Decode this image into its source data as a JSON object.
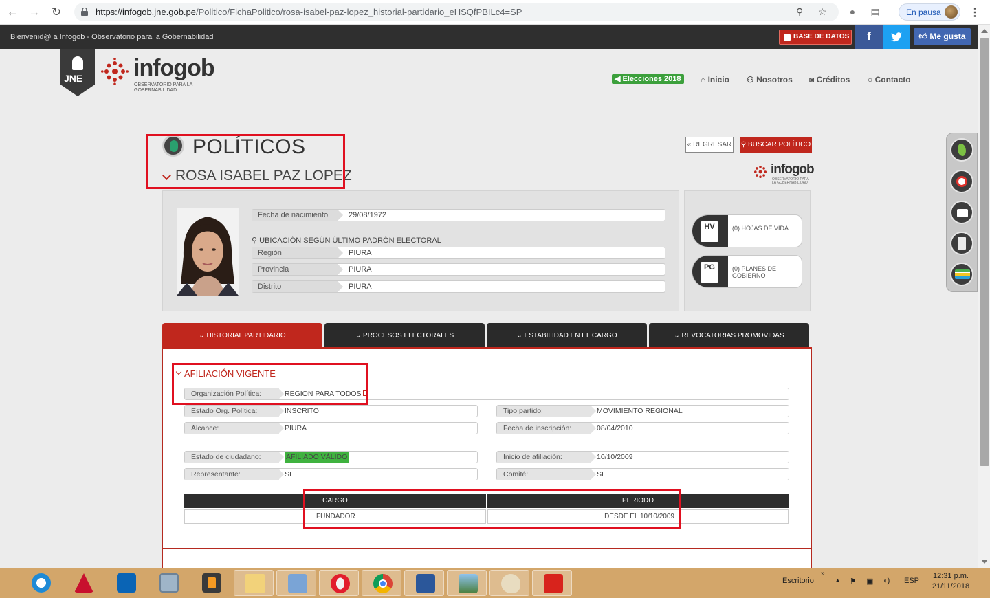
{
  "browser": {
    "url_host": "https://infogob.jne.gob.pe",
    "url_path": "/Politico/FichaPolitico/rosa-isabel-paz-lopez_historial-partidario_eHSQfPBILc4=SP",
    "profile_status": "En pausa"
  },
  "topbar": {
    "welcome": "Bienvenid@ a Infogob - Observatorio para la Gobernabilidad",
    "db_button": "BASE DE DATOS",
    "facebook": "f",
    "twitter": "t",
    "like_button": "Me gusta"
  },
  "header": {
    "jne": "JNE",
    "brand": "infogob",
    "brand_sub": "OBSERVATORIO PARA LA GOBERNABILIDAD",
    "nav": {
      "elections": "Elecciones 2018",
      "home": "Inicio",
      "about": "Nosotros",
      "credits": "Créditos",
      "contact": "Contacto"
    }
  },
  "page": {
    "title": "POLÍTICOS",
    "person_name": "ROSA ISABEL PAZ LOPEZ",
    "back_button": "« REGRESAR",
    "search_button": "BUSCAR POLÍTICO"
  },
  "profile": {
    "birth_label": "Fecha de nacimiento",
    "birth_value": "29/08/1972",
    "location_heading": "UBICACIÓN SEGÚN ÚLTIMO PADRÓN ELECTORAL",
    "region_label": "Región",
    "region_value": "PIURA",
    "province_label": "Provincia",
    "province_value": "PIURA",
    "district_label": "Distrito",
    "district_value": "PIURA"
  },
  "documents": {
    "hv_code": "HV",
    "hv_text": "(0) HOJAS DE VIDA",
    "pg_code": "PG",
    "pg_text": "(0) PLANES DE GOBIERNO"
  },
  "tabs": [
    {
      "label": "HISTORIAL PARTIDARIO"
    },
    {
      "label": "PROCESOS ELECTORALES"
    },
    {
      "label": "ESTABILIDAD EN EL CARGO"
    },
    {
      "label": "REVOCATORIAS PROMOVIDAS"
    }
  ],
  "affiliation": {
    "heading": "AFILIACIÓN VIGENTE",
    "org_label": "Organización Política:",
    "org_value": "REGION PARA TODOS",
    "state_label": "Estado Org. Política:",
    "state_value": "INSCRITO",
    "type_label": "Tipo partido:",
    "type_value": "MOVIMIENTO REGIONAL",
    "scope_label": "Alcance:",
    "scope_value": "PIURA",
    "reg_date_label": "Fecha de inscripción:",
    "reg_date_value": "08/04/2010",
    "citizen_label": "Estado de ciudadano:",
    "citizen_value": "AFILIADO VÁLIDO",
    "start_label": "Inicio de afiliación:",
    "start_value": "10/10/2009",
    "rep_label": "Representante:",
    "rep_value": "SI",
    "committee_label": "Comité:",
    "committee_value": "SI"
  },
  "positions": {
    "col_cargo": "CARGO",
    "col_period": "PERIODO",
    "rows": [
      {
        "cargo": "FUNDADOR",
        "period": "DESDE EL 10/10/2009"
      }
    ]
  },
  "taskbar": {
    "desktop": "Escritorio",
    "lang": "ESP",
    "time": "12:31 p.m.",
    "date": "21/11/2018"
  },
  "colors": {
    "accent_red": "#c0271d",
    "dark": "#2a2a2a",
    "taskbar": "#d3a66a",
    "success_green": "#3fb23f"
  }
}
